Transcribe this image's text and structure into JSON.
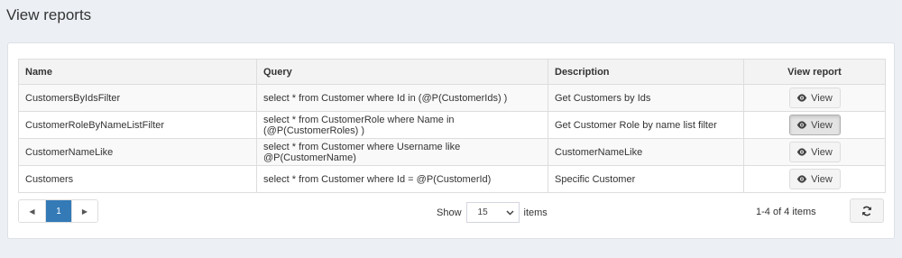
{
  "page": {
    "title": "View reports"
  },
  "table": {
    "headers": [
      "Name",
      "Query",
      "Description",
      "View report"
    ],
    "rows": [
      {
        "name": "CustomersByIdsFilter",
        "query": "select * from Customer where Id in (@P(CustomerIds) )",
        "description": "Get Customers by Ids",
        "action": "View"
      },
      {
        "name": "CustomerRoleByNameListFilter",
        "query": "select * from CustomerRole where Name in (@P(CustomerRoles) )",
        "description": "Get Customer Role by name list filter",
        "action": "View"
      },
      {
        "name": "CustomerNameLike",
        "query": "select * from Customer where Username like @P(CustomerName)",
        "description": "CustomerNameLike",
        "action": "View"
      },
      {
        "name": "Customers",
        "query": "select * from Customer where Id = @P(CustomerId)",
        "description": "Specific Customer",
        "action": "View"
      }
    ]
  },
  "pager": {
    "prev_icon": "caret-left-icon",
    "current_page": "1",
    "next_icon": "caret-right-icon"
  },
  "page_size": {
    "show_label": "Show",
    "selected": "15",
    "items_label": "items"
  },
  "count_text": "1-4 of 4 items",
  "icons": {
    "view": "eye-icon",
    "refresh": "refresh-icon"
  },
  "colors": {
    "accent": "#337ab7",
    "background": "#ecf0f5"
  }
}
